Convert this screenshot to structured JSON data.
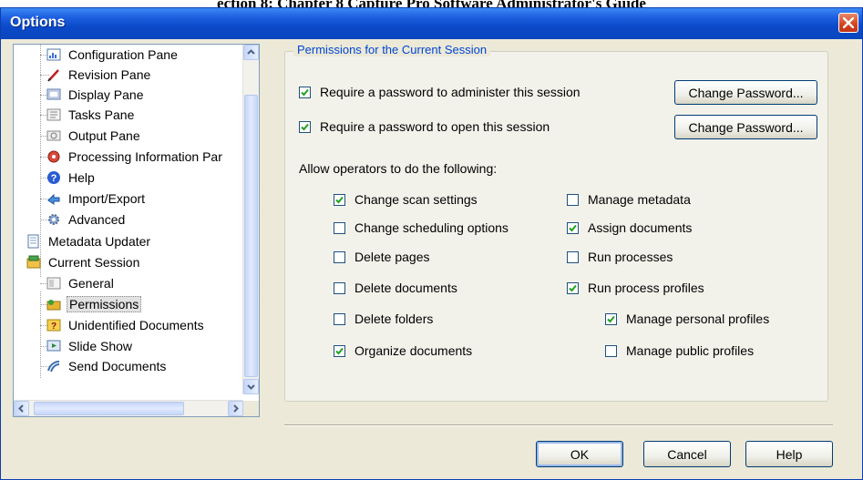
{
  "dialog": {
    "title": "Options"
  },
  "page_top_text": "ection 8: Chapter 8 Capture Pro Software Administrator's Guide",
  "tree": {
    "items": [
      {
        "label": "Configuration Pane",
        "icon": "configuration-pane-icon"
      },
      {
        "label": "Revision Pane",
        "icon": "revision-pane-icon"
      },
      {
        "label": "Display Pane",
        "icon": "display-pane-icon"
      },
      {
        "label": "Tasks Pane",
        "icon": "tasks-pane-icon"
      },
      {
        "label": "Output Pane",
        "icon": "output-pane-icon"
      },
      {
        "label": "Processing Information Par",
        "icon": "processing-information-icon"
      },
      {
        "label": "Help",
        "icon": "help-icon"
      },
      {
        "label": "Import/Export",
        "icon": "import-export-icon"
      },
      {
        "label": "Advanced",
        "icon": "advanced-gear-icon"
      },
      {
        "label": "Metadata Updater",
        "icon": "metadata-updater-icon"
      },
      {
        "label": "Current Session",
        "icon": "current-session-icon"
      },
      {
        "label": "General",
        "icon": "general-icon"
      },
      {
        "label": "Permissions",
        "icon": "permissions-icon",
        "selected": true
      },
      {
        "label": "Unidentified Documents",
        "icon": "unidentified-documents-icon"
      },
      {
        "label": "Slide Show",
        "icon": "slide-show-icon"
      },
      {
        "label": "Send Documents",
        "icon": "send-documents-icon"
      }
    ]
  },
  "permissions": {
    "group_title": "Permissions for the Current Session",
    "require_admin_password": {
      "label": "Require a password to administer this session",
      "checked": true
    },
    "require_open_password": {
      "label": "Require a password to open this session",
      "checked": true
    },
    "change_password_label": "Change Password...",
    "allow_label": "Allow operators to do the following:",
    "options_left": [
      {
        "label": "Change scan settings",
        "checked": true
      },
      {
        "label": "Change scheduling options",
        "checked": false
      },
      {
        "label": "Delete pages",
        "checked": false
      },
      {
        "label": "Delete documents",
        "checked": false
      },
      {
        "label": "Delete folders",
        "checked": false
      },
      {
        "label": "Organize documents",
        "checked": true
      }
    ],
    "options_right": [
      {
        "label": "Manage metadata",
        "checked": false
      },
      {
        "label": "Assign documents",
        "checked": true
      },
      {
        "label": "Run processes",
        "checked": false
      },
      {
        "label": "Run process profiles",
        "checked": true
      }
    ],
    "options_sub": [
      {
        "label": "Manage personal profiles",
        "checked": true
      },
      {
        "label": "Manage public profiles",
        "checked": false
      }
    ]
  },
  "buttons": {
    "ok": "OK",
    "cancel": "Cancel",
    "help": "Help"
  },
  "colors": {
    "title_bar": "#0b46c0",
    "dialog_bg": "#ece9d8",
    "group_title": "#0046d5",
    "checkmark": "#21a121"
  }
}
